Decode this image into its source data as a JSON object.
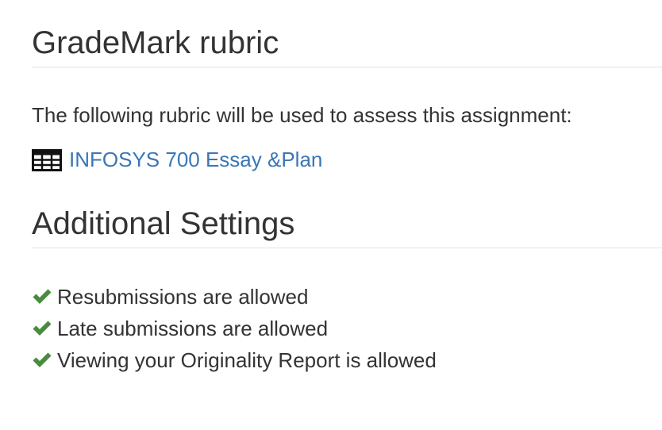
{
  "grademark": {
    "heading": "GradeMark rubric",
    "intro": "The following rubric will be used to assess this assignment:",
    "rubric_link_label": "INFOSYS 700 Essay &Plan",
    "icon": "table-icon",
    "link_color": "#3a76b6"
  },
  "additional_settings": {
    "heading": "Additional Settings",
    "check_icon": "check-icon",
    "check_color": "#4a8b3f",
    "items": [
      {
        "label": "Resubmissions are allowed"
      },
      {
        "label": "Late submissions are allowed"
      },
      {
        "label": "Viewing your Originality Report is allowed"
      }
    ]
  }
}
